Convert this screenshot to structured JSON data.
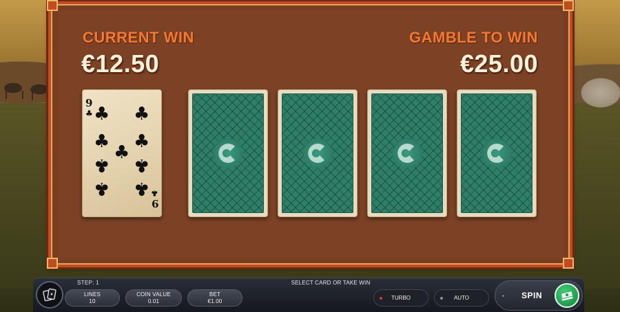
{
  "game": {
    "current_win_label": "CURRENT WIN",
    "current_win_value": "€12.50",
    "gamble_label": "GAMBLE TO WIN",
    "gamble_value": "€25.00"
  },
  "revealed_card": {
    "rank": "9",
    "suit": "clubs",
    "suit_glyph": "♣"
  },
  "face_down_cards": [
    {
      "icon": "card-back-emblem-icon"
    },
    {
      "icon": "card-back-emblem-icon"
    },
    {
      "icon": "card-back-emblem-icon"
    },
    {
      "icon": "card-back-emblem-icon"
    }
  ],
  "controls": {
    "step": "STEP: 1",
    "message": "SELECT CARD OR TAKE WIN",
    "lines_label": "LINES",
    "lines_value": "10",
    "coin_value_label": "COIN VALUE",
    "coin_value_value": "0.01",
    "bet_label": "BET",
    "bet_value": "€1.00",
    "turbo_label": "TURBO",
    "auto_label": "AUTO",
    "spin_label": "SPIN",
    "menu_icon": "cards-menu-icon",
    "collect_icon": "cash-stack-icon"
  },
  "colors": {
    "board": "#7d4226",
    "frame": "#c14b22",
    "label_orange": "#f27a34",
    "card_back_green": "#2f7e69",
    "spin_green": "#1f9a4c",
    "turbo_dot": "#d83a3a"
  }
}
